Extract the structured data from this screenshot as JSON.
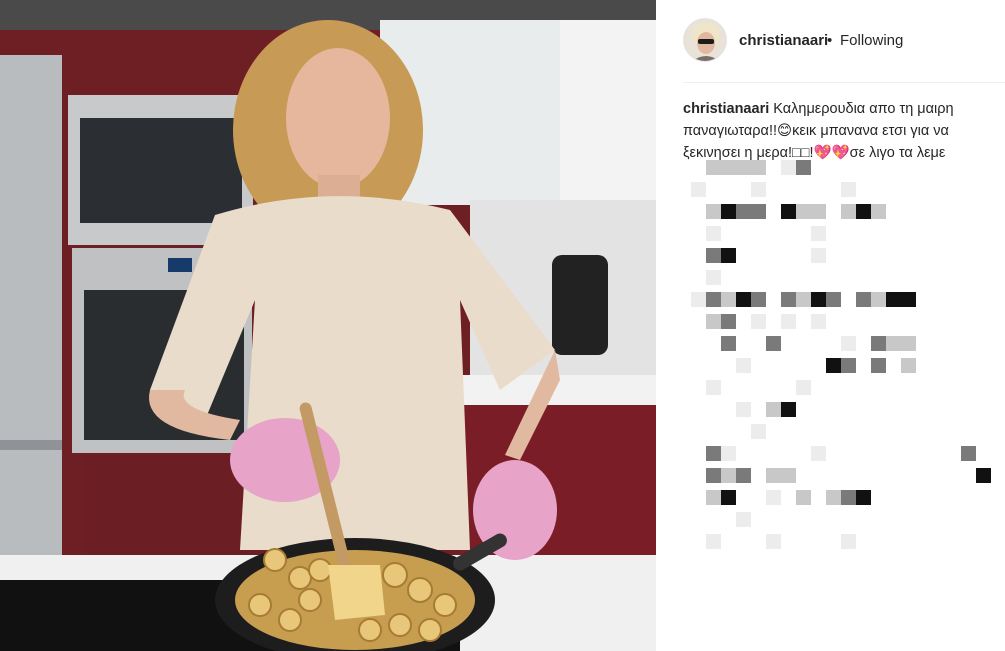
{
  "post": {
    "username": "christianaari",
    "separator": "•",
    "follow_status": "Following",
    "caption_text": "Καλημερουδια απο τη μαιρη παναγιωταρα!!😊κεικ μπανανα ετσι για να ξεκινησει η μερα!□□!💖💖σε λιγο τα λεμε"
  },
  "photo": {
    "icon": "kitchen-cooking-photo"
  },
  "colors": {
    "text": "#262626",
    "divider": "#efefef",
    "pixel_dark": "#111111",
    "pixel_mid": "#7a7a7a",
    "pixel_light": "#c8c8c8",
    "pixel_faint": "#ececec"
  }
}
